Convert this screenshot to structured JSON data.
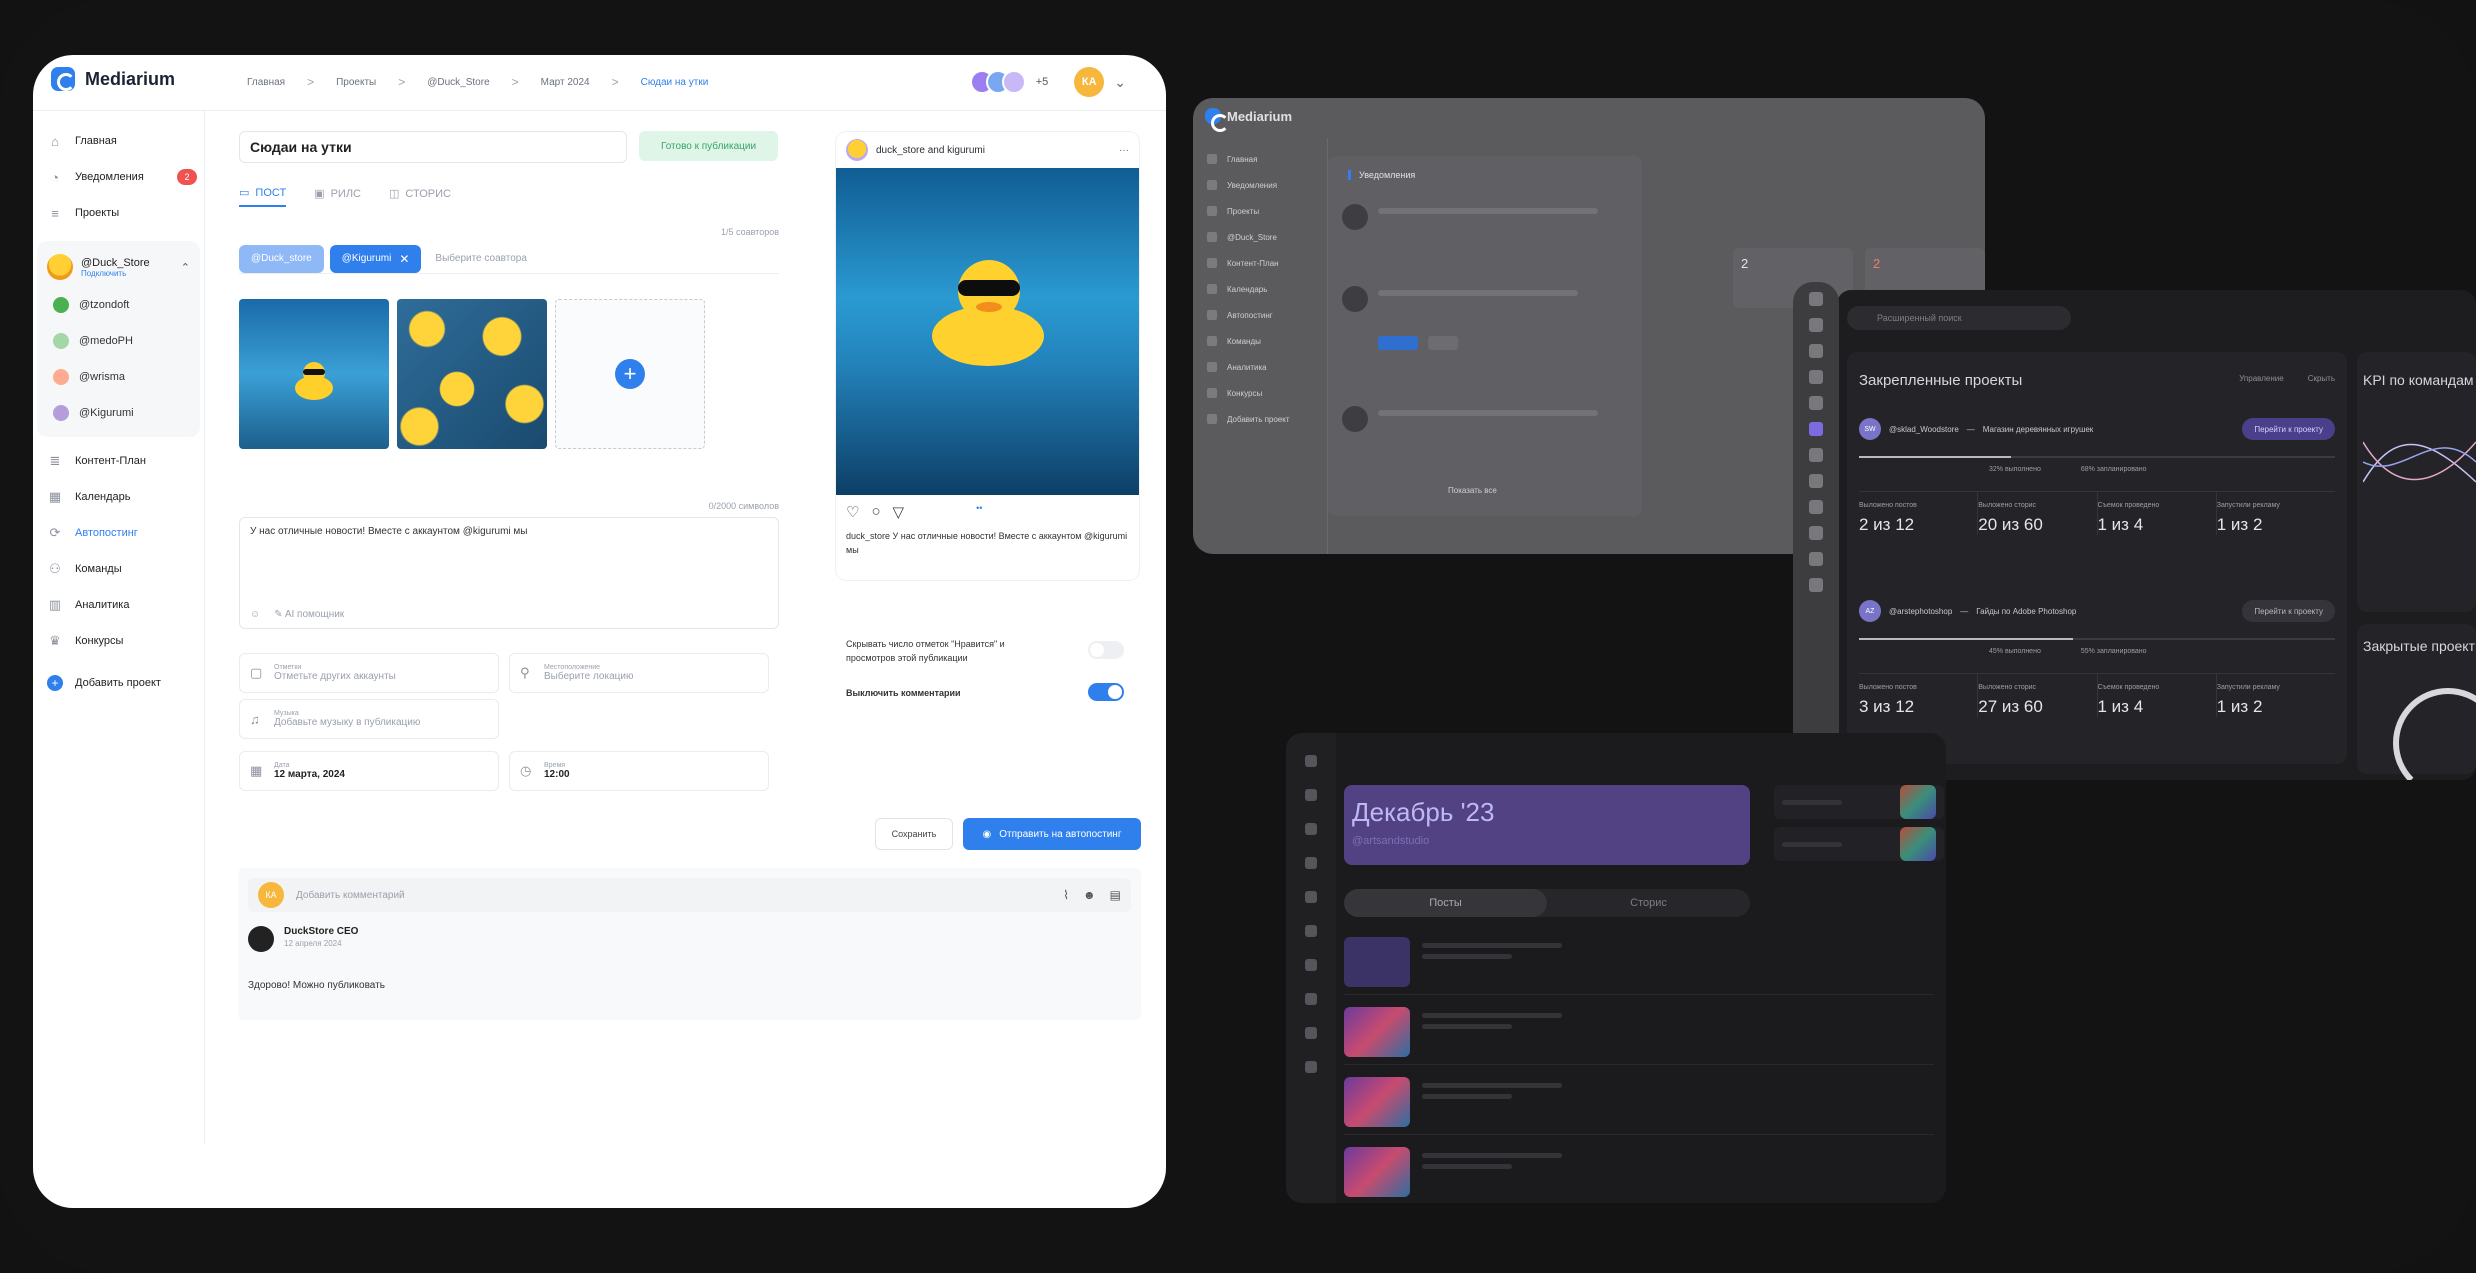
{
  "app": {
    "brand": "Mediarium",
    "breadcrumbs": [
      "Главная",
      "Проекты",
      "@Duck_Store",
      "Март 2024",
      "Сюдаи на утки"
    ],
    "top": {
      "extra_count": "+5",
      "me_initials": "КА"
    }
  },
  "sidebar": {
    "main_items": [
      {
        "label": "Главная",
        "icon": "home-icon"
      },
      {
        "label": "Уведомления",
        "icon": "bell-icon",
        "badge": "2"
      },
      {
        "label": "Проекты",
        "icon": "list-icon"
      }
    ],
    "project": {
      "name": "@Duck_Store",
      "sub": "Подключить"
    },
    "project_accounts": [
      {
        "label": "@tzondoft",
        "color": "#4caf50"
      },
      {
        "label": "@medoPH",
        "color": "#a5d6a7"
      },
      {
        "label": "@wrisma",
        "color": "#ffab91"
      },
      {
        "label": "@Kigurumi",
        "color": "#b39ddb"
      }
    ],
    "bottom_items": [
      {
        "label": "Контент-План",
        "icon": "content-plan-icon"
      },
      {
        "label": "Календарь",
        "icon": "calendar-icon"
      },
      {
        "label": "Автопостинг",
        "icon": "autopost-icon",
        "active": true
      },
      {
        "label": "Команды",
        "icon": "team-icon"
      },
      {
        "label": "Аналитика",
        "icon": "analytics-icon"
      },
      {
        "label": "Конкурсы",
        "icon": "trophy-icon"
      }
    ],
    "add_project": "Добавить проект"
  },
  "editor": {
    "title": "Сюдаи на утки",
    "status": "Готово к публикации",
    "tabs": [
      "ПОСТ",
      "РИЛС",
      "СТОРИС"
    ],
    "accounts_counter": "1/5 соавторов",
    "chips": [
      "@Duck_store",
      "@Kigurumi"
    ],
    "accounts_placeholder": "Выберите соавтора",
    "text_counter": "0/2000 символов",
    "text": "У нас отличные новости! Вместе с аккаунтом @kigurumi мы",
    "ai_hint": "AI помощник",
    "tag": {
      "label": "Отметки",
      "placeholder": "Отметьте других аккаунты"
    },
    "location": {
      "label": "Местоположение",
      "placeholder": "Выберите локацию"
    },
    "music": {
      "label": "Музыка",
      "placeholder": "Добавьте музыку в публикацию"
    },
    "date": {
      "label": "Дата",
      "value": "12 марта, 2024"
    },
    "time": {
      "label": "Время",
      "value": "12:00"
    }
  },
  "preview": {
    "header": "duck_store and kigurumi",
    "text": "duck_store У нас отличные новости! Вместе с аккаунтом @kigurumi мы"
  },
  "settings": {
    "hide_likes": "Скрывать число отметок \"Нравится\" и просмотров этой публикации",
    "hide_likes_on": false,
    "comments_off": "Выключить комментарии",
    "comments_off_on": true
  },
  "actions": {
    "save": "Сохранить",
    "send": "Отправить на автопостинг"
  },
  "comments": {
    "placeholder": "Добавить комментарий",
    "author": "DuckStore CEO",
    "date": "12 апреля 2024",
    "body": "Здорово! Можно публиковать"
  },
  "ghost_notifications": {
    "brand": "Mediarium",
    "nav": [
      "Главная",
      "Уведомления",
      "Проекты",
      "@Duck_Store",
      "Контент-План",
      "Календарь",
      "Автопостинг",
      "Команды",
      "Аналитика",
      "Конкурсы",
      "Добавить проект"
    ],
    "title": "Уведомления",
    "show_all": "Показать все",
    "stat_values": [
      "2",
      "2"
    ]
  },
  "ghost_dashboard": {
    "search": "Расширенный поиск",
    "pinned_title": "Закрепленные проекты",
    "head_right": [
      "Управление",
      "Скрыть"
    ],
    "projects": [
      {
        "initials": "SW",
        "name": "@sklad_Woodstore",
        "desc": "Магазин деревянных игрушек",
        "button": "Перейти к проекту",
        "progress": 0.32,
        "progress_labels": [
          "32% выполнено",
          "68% запланировано"
        ],
        "metrics": [
          {
            "label": "Выложено постов",
            "value": "2 из 12"
          },
          {
            "label": "Выложено сторис",
            "value": "20 из 60"
          },
          {
            "label": "Съемок проведено",
            "value": "1 из 4"
          },
          {
            "label": "Запустили рекламу",
            "value": "1 из 2"
          }
        ]
      },
      {
        "initials": "AZ",
        "name": "@arstephotoshop",
        "desc": "Гайды по Adobe Photoshop",
        "button": "Перейти к проекту",
        "progress": 0.45,
        "progress_labels": [
          "45% выполнено",
          "55% запланировано"
        ],
        "metrics": [
          {
            "label": "Выложено постов",
            "value": "3 из 12"
          },
          {
            "label": "Выложено сторис",
            "value": "27 из 60"
          },
          {
            "label": "Съемок проведено",
            "value": "1 из 4"
          },
          {
            "label": "Запустили рекламу",
            "value": "1 из 2"
          }
        ]
      }
    ],
    "kpi_title": "KPI по командам",
    "closed_title": "Закрытые проекты"
  },
  "ghost_plan": {
    "banner_title": "Декабрь '23",
    "banner_sub": "@artsandstudio",
    "tabs": [
      "Посты",
      "Сторис"
    ]
  }
}
